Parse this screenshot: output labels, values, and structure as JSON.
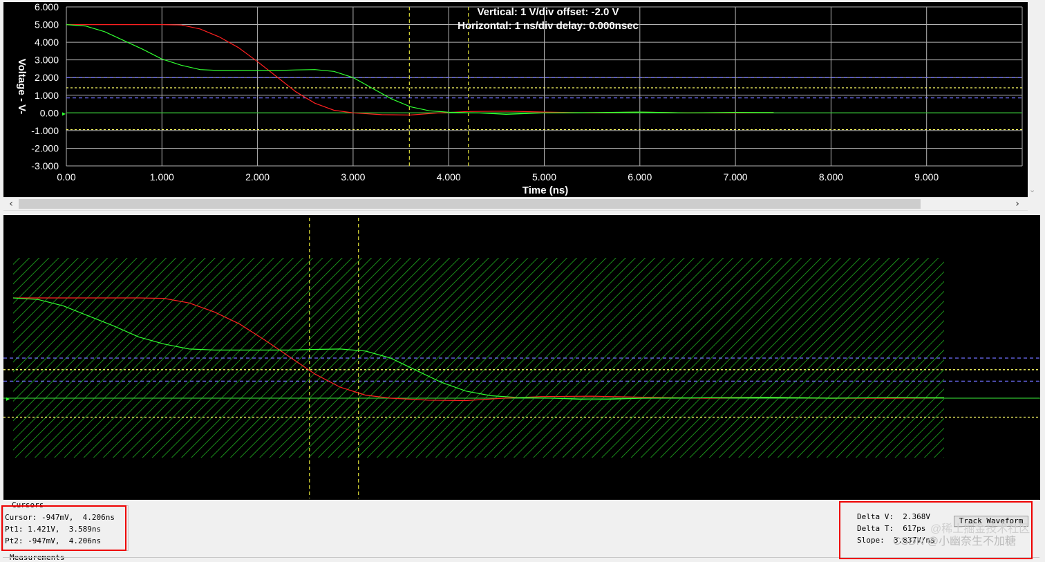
{
  "scope": {
    "header_vertical": "Vertical: 1  V/div  offset: -2.0 V",
    "header_horizontal": "Horizontal: 1 ns/div  delay: 0.000nsec",
    "y_axis_label": "Voltage  -  V-",
    "x_axis_label": "Time  (ns)"
  },
  "chart_data": {
    "type": "line",
    "title": "",
    "xlabel": "Time  (ns)",
    "ylabel": "Voltage  -  V-",
    "xlim": [
      0,
      10
    ],
    "ylim": [
      -3,
      6
    ],
    "x_ticks": [
      "0.00",
      "1.000",
      "2.000",
      "3.000",
      "4.000",
      "5.000",
      "6.000",
      "7.000",
      "8.000",
      "9.000"
    ],
    "y_ticks": [
      "6.000",
      "5.000",
      "4.000",
      "3.000",
      "2.000",
      "1.000",
      "0.00",
      "-1.000",
      "-2.000",
      "-3.000"
    ],
    "grid": true,
    "series": [
      {
        "color": "#ff2020",
        "x": [
          0,
          0.5,
          1.0,
          1.2,
          1.4,
          1.6,
          1.8,
          2.0,
          2.2,
          2.4,
          2.6,
          2.8,
          3.0,
          3.3,
          3.6,
          3.9,
          4.2,
          4.6,
          5.0,
          5.5,
          6.0,
          6.5,
          7.0,
          7.4
        ],
        "y": [
          5.0,
          5.0,
          5.0,
          4.98,
          4.75,
          4.3,
          3.7,
          2.9,
          2.05,
          1.2,
          0.55,
          0.15,
          0.0,
          -0.1,
          -0.12,
          0.0,
          0.08,
          0.1,
          0.05,
          0.0,
          0.05,
          0.0,
          0.0,
          0.02
        ]
      },
      {
        "color": "#30ff30",
        "x": [
          0,
          0.2,
          0.4,
          0.6,
          0.8,
          1.0,
          1.2,
          1.4,
          1.6,
          1.8,
          2.0,
          2.2,
          2.4,
          2.6,
          2.8,
          3.0,
          3.2,
          3.4,
          3.6,
          3.8,
          4.0,
          4.3,
          4.6,
          5.0,
          5.5,
          6.0,
          6.5,
          7.0,
          7.4
        ],
        "y": [
          5.0,
          4.92,
          4.6,
          4.1,
          3.6,
          3.05,
          2.7,
          2.45,
          2.4,
          2.4,
          2.4,
          2.4,
          2.43,
          2.45,
          2.35,
          2.0,
          1.4,
          0.8,
          0.35,
          0.12,
          0.04,
          0.0,
          -0.08,
          0.0,
          0.02,
          0.05,
          0.0,
          0.03,
          0.02
        ]
      }
    ],
    "reference_lines": [
      {
        "axis": "y",
        "value": 1.421,
        "color": "#ffff66",
        "style": "dotted"
      },
      {
        "axis": "y",
        "value": -0.947,
        "color": "#ffff66",
        "style": "dotted"
      },
      {
        "axis": "y",
        "value": 2.0,
        "color": "#7070ff",
        "style": "dashed"
      },
      {
        "axis": "y",
        "value": 0.85,
        "color": "#7070ff",
        "style": "dashed"
      },
      {
        "axis": "y",
        "value": 0.0,
        "color": "#30c030",
        "style": "solid"
      },
      {
        "axis": "x",
        "value": 3.589,
        "color": "#cccc33",
        "style": "dashed"
      },
      {
        "axis": "x",
        "value": 4.206,
        "color": "#cccc33",
        "style": "dashed"
      }
    ]
  },
  "cursors": {
    "title": "Cursors",
    "cursor": "Cursor: -947mV,  4.206ns",
    "pt1": "Pt1: 1.421V,  3.589ns",
    "pt2": "Pt2: -947mV,  4.206ns"
  },
  "measurements": {
    "title": "Measurements",
    "delta_v": "Delta V:  2.368V",
    "delta_t": "Delta T:  617ps",
    "slope": "Slope:  3.837V/ns",
    "track_button": "Track Waveform"
  },
  "watermark": {
    "line1": "@稀土掘金技术社区",
    "line2": "CSDN @小幽奈生不加糖"
  }
}
